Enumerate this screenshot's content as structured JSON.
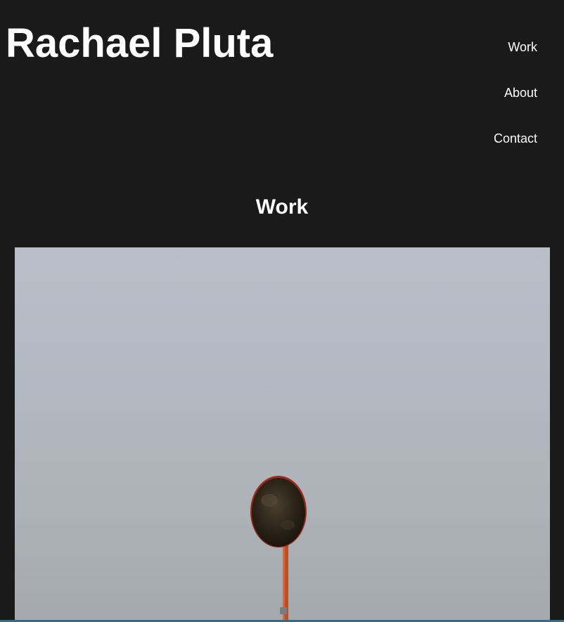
{
  "site": {
    "title": "Rachael Pluta"
  },
  "nav": {
    "items": [
      {
        "label": "Work"
      },
      {
        "label": "About"
      },
      {
        "label": "Contact"
      }
    ]
  },
  "main": {
    "heading": "Work",
    "photo": {
      "subject": "road-mirror-photo"
    }
  },
  "colors": {
    "background": "#1a1a1a",
    "text": "#ffffff",
    "sky": "#b3b9c2",
    "pole": "#c0502a",
    "accent_strip": "#2d6f86"
  }
}
